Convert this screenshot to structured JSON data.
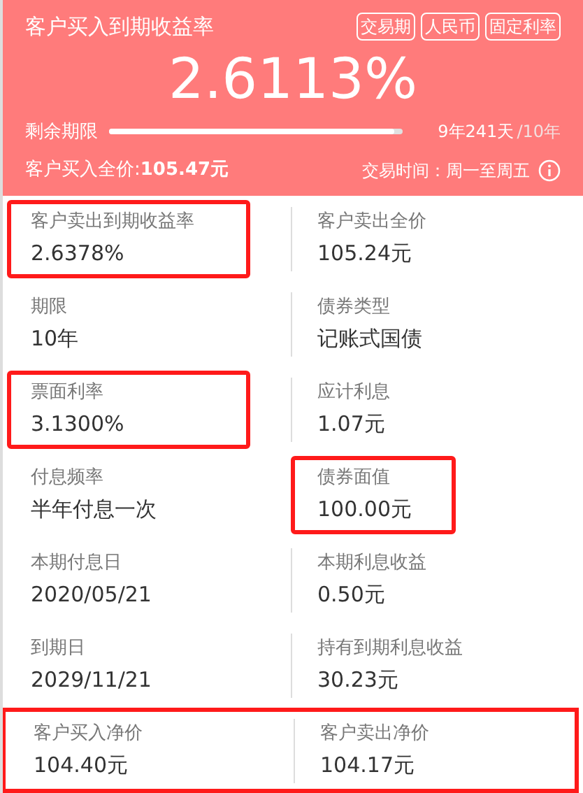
{
  "header": {
    "title": "客户买入到期收益率",
    "tags": [
      "交易期",
      "人民币",
      "固定利率"
    ],
    "rate": "2.6113%",
    "remaining": {
      "label": "剩余期限",
      "level": 0.97,
      "value": "9年241天",
      "total": "/10年"
    },
    "full_price": {
      "label": "客户买入全价:",
      "value": "105.47元"
    },
    "trading_time": "交易时间：周一至周五"
  },
  "rows": [
    {
      "highlighted": false,
      "items": [
        {
          "label": "客户卖出到期收益率",
          "value": "2.6378%",
          "highlighted": true
        },
        {
          "label": "客户卖出全价",
          "value": "105.24元",
          "highlighted": false
        }
      ]
    },
    {
      "highlighted": false,
      "items": [
        {
          "label": "期限",
          "value": "10年",
          "highlighted": false
        },
        {
          "label": "债券类型",
          "value": "记账式国债",
          "highlighted": false
        }
      ]
    },
    {
      "highlighted": false,
      "items": [
        {
          "label": "票面利率",
          "value": "3.1300%",
          "highlighted": true
        },
        {
          "label": "应计利息",
          "value": "1.07元",
          "highlighted": false
        }
      ]
    },
    {
      "highlighted": false,
      "items": [
        {
          "label": "付息频率",
          "value": "半年付息一次",
          "highlighted": false
        },
        {
          "label": "债券面值",
          "value": "100.00元",
          "highlighted": true
        }
      ]
    },
    {
      "highlighted": false,
      "items": [
        {
          "label": "本期付息日",
          "value": "2020/05/21",
          "highlighted": false
        },
        {
          "label": "本期利息收益",
          "value": "0.50元",
          "highlighted": false
        }
      ]
    },
    {
      "highlighted": false,
      "items": [
        {
          "label": "到期日",
          "value": "2029/11/21",
          "highlighted": false
        },
        {
          "label": "持有到期利息收益",
          "value": "30.23元",
          "highlighted": false
        }
      ]
    },
    {
      "highlighted": true,
      "items": [
        {
          "label": "客户买入净价",
          "value": "104.40元",
          "highlighted": false
        },
        {
          "label": "客户卖出净价",
          "value": "104.17元",
          "highlighted": false
        }
      ]
    }
  ]
}
